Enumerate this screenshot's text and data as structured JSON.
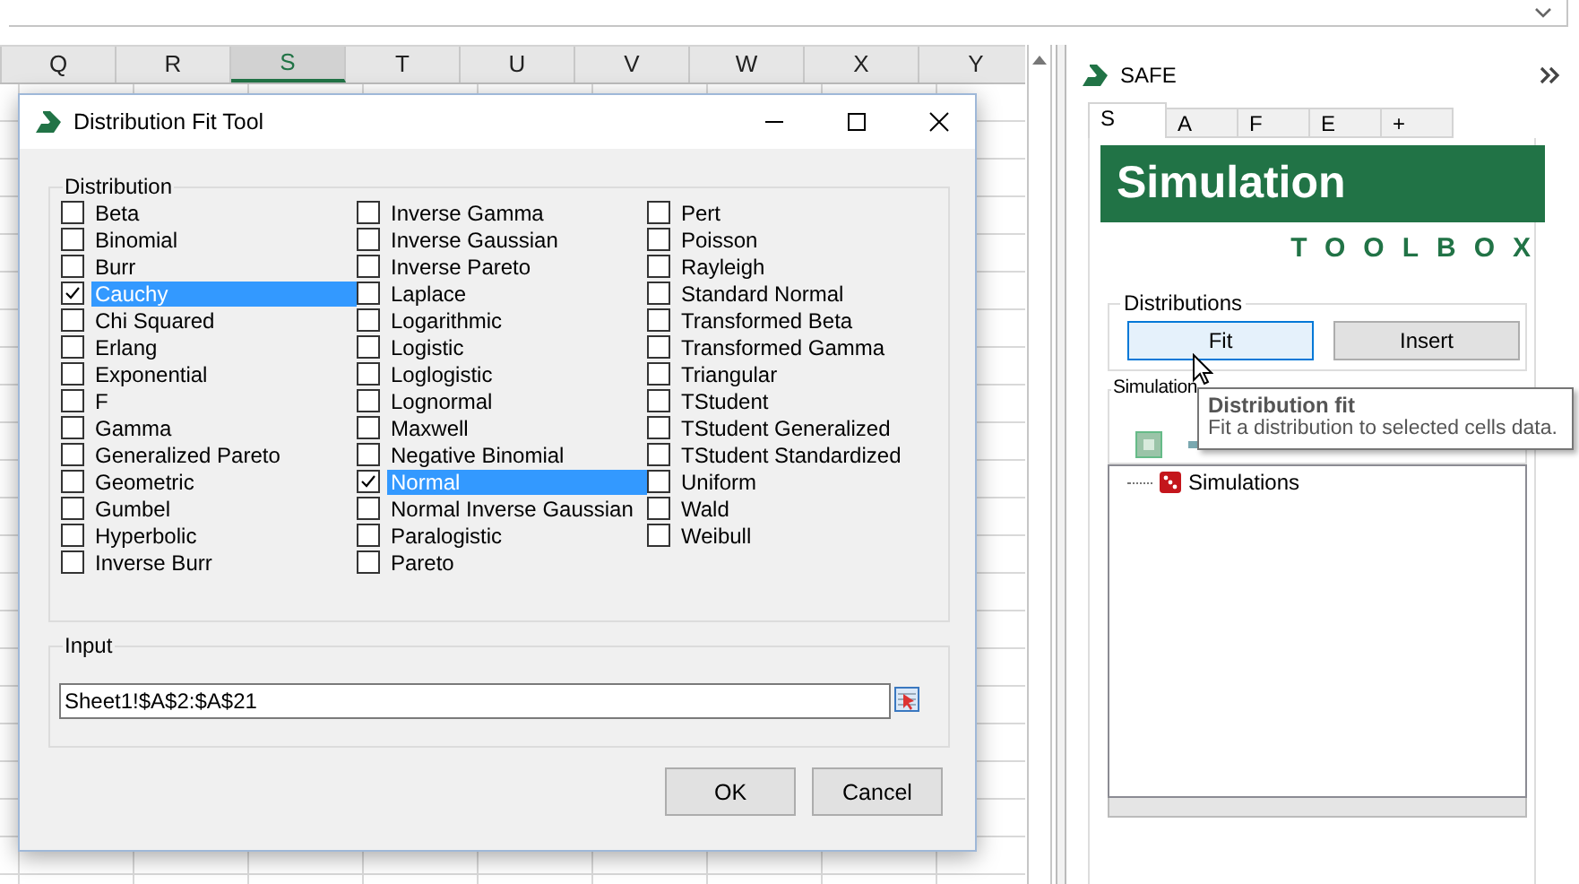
{
  "sheet": {
    "columns": [
      {
        "label": "Q",
        "selected": false
      },
      {
        "label": "R",
        "selected": false
      },
      {
        "label": "S",
        "selected": true
      },
      {
        "label": "T",
        "selected": false
      },
      {
        "label": "U",
        "selected": false
      },
      {
        "label": "V",
        "selected": false
      },
      {
        "label": "W",
        "selected": false
      },
      {
        "label": "X",
        "selected": false
      },
      {
        "label": "Y",
        "selected": false
      }
    ]
  },
  "dialog": {
    "title": "Distribution Fit Tool",
    "distribution_group": "Distribution",
    "columns": [
      [
        {
          "label": "Beta",
          "checked": false,
          "selected": false
        },
        {
          "label": "Binomial",
          "checked": false,
          "selected": false
        },
        {
          "label": "Burr",
          "checked": false,
          "selected": false
        },
        {
          "label": "Cauchy",
          "checked": true,
          "selected": true
        },
        {
          "label": "Chi Squared",
          "checked": false,
          "selected": false
        },
        {
          "label": "Erlang",
          "checked": false,
          "selected": false
        },
        {
          "label": "Exponential",
          "checked": false,
          "selected": false
        },
        {
          "label": "F",
          "checked": false,
          "selected": false
        },
        {
          "label": "Gamma",
          "checked": false,
          "selected": false
        },
        {
          "label": "Generalized Pareto",
          "checked": false,
          "selected": false
        },
        {
          "label": "Geometric",
          "checked": false,
          "selected": false
        },
        {
          "label": "Gumbel",
          "checked": false,
          "selected": false
        },
        {
          "label": "Hyperbolic",
          "checked": false,
          "selected": false
        },
        {
          "label": "Inverse Burr",
          "checked": false,
          "selected": false
        }
      ],
      [
        {
          "label": "Inverse Gamma",
          "checked": false,
          "selected": false
        },
        {
          "label": "Inverse Gaussian",
          "checked": false,
          "selected": false
        },
        {
          "label": "Inverse Pareto",
          "checked": false,
          "selected": false
        },
        {
          "label": "Laplace",
          "checked": false,
          "selected": false
        },
        {
          "label": "Logarithmic",
          "checked": false,
          "selected": false
        },
        {
          "label": "Logistic",
          "checked": false,
          "selected": false
        },
        {
          "label": "Loglogistic",
          "checked": false,
          "selected": false
        },
        {
          "label": "Lognormal",
          "checked": false,
          "selected": false
        },
        {
          "label": "Maxwell",
          "checked": false,
          "selected": false
        },
        {
          "label": "Negative Binomial",
          "checked": false,
          "selected": false
        },
        {
          "label": "Normal",
          "checked": true,
          "selected": true
        },
        {
          "label": "Normal Inverse Gaussian",
          "checked": false,
          "selected": false
        },
        {
          "label": "Paralogistic",
          "checked": false,
          "selected": false
        },
        {
          "label": "Pareto",
          "checked": false,
          "selected": false
        }
      ],
      [
        {
          "label": "Pert",
          "checked": false,
          "selected": false
        },
        {
          "label": "Poisson",
          "checked": false,
          "selected": false
        },
        {
          "label": "Rayleigh",
          "checked": false,
          "selected": false
        },
        {
          "label": "Standard Normal",
          "checked": false,
          "selected": false
        },
        {
          "label": "Transformed Beta",
          "checked": false,
          "selected": false
        },
        {
          "label": "Transformed Gamma",
          "checked": false,
          "selected": false
        },
        {
          "label": "Triangular",
          "checked": false,
          "selected": false
        },
        {
          "label": "TStudent",
          "checked": false,
          "selected": false
        },
        {
          "label": "TStudent Generalized",
          "checked": false,
          "selected": false
        },
        {
          "label": "TStudent Standardized",
          "checked": false,
          "selected": false
        },
        {
          "label": "Uniform",
          "checked": false,
          "selected": false
        },
        {
          "label": "Wald",
          "checked": false,
          "selected": false
        },
        {
          "label": "Weibull",
          "checked": false,
          "selected": false
        }
      ]
    ],
    "input_group": "Input",
    "input_value": "Sheet1!$A$2:$A$21",
    "buttons": [
      "OK",
      "Cancel"
    ]
  },
  "panel": {
    "title": "SAFE",
    "tabs": [
      {
        "label": "S",
        "selected": true
      },
      {
        "label": "A",
        "selected": false
      },
      {
        "label": "F",
        "selected": false
      },
      {
        "label": "E",
        "selected": false
      },
      {
        "label": "+",
        "selected": false
      }
    ],
    "banner": "Simulation",
    "subtitle": "TOOLBOX",
    "distributions_group": "Distributions",
    "buttons": [
      {
        "label": "Fit",
        "hover": true
      },
      {
        "label": "Insert",
        "hover": false
      }
    ],
    "simulations_group": "Simulation",
    "tree": [
      {
        "label": "Simulations"
      }
    ]
  },
  "tooltip": {
    "title": "Distribution fit",
    "text": "Fit a distribution to selected cells data."
  }
}
